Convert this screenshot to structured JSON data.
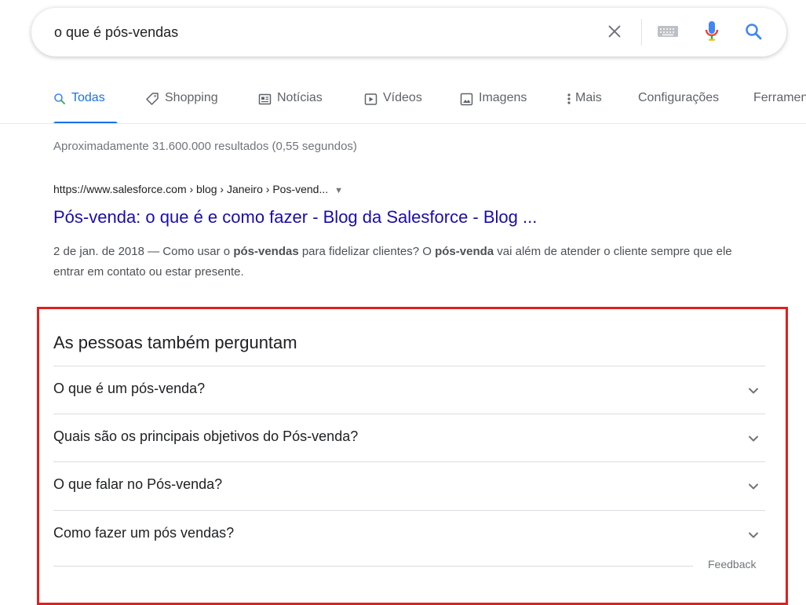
{
  "search": {
    "query": "o que é pós-vendas",
    "clear_icon": "close-icon",
    "keyboard_icon": "keyboard-icon",
    "mic_icon": "microphone-icon",
    "search_icon": "search-icon"
  },
  "tabs": [
    {
      "label": "Todas",
      "icon": "search-icon",
      "active": true
    },
    {
      "label": "Shopping",
      "icon": "tag-icon"
    },
    {
      "label": "Notícias",
      "icon": "newspaper-icon"
    },
    {
      "label": "Vídeos",
      "icon": "play-icon"
    },
    {
      "label": "Imagens",
      "icon": "image-icon"
    },
    {
      "label": "Mais",
      "icon": "more-vert-icon"
    },
    {
      "label": "Configurações"
    },
    {
      "label": "Ferramentas"
    }
  ],
  "results_stats": "Aproximadamente 31.600.000 resultados (0,55 segundos)",
  "result": {
    "url": "https://www.salesforce.com › blog › Janeiro › Pos-vend...",
    "url_caret": "▼",
    "title": "Pós-venda: o que é e como fazer - Blog da Salesforce - Blog ...",
    "snippet_date": "2 de jan. de 2018 — Como usar o ",
    "snippet_b1": "pós-vendas",
    "snippet_t2": " para fidelizar clientes? O ",
    "snippet_b2": "pós-venda",
    "snippet_t3": " vai além de atender o cliente sempre que ele entrar em contato ou estar presente."
  },
  "paa": {
    "heading": "As pessoas também perguntam",
    "questions": [
      "O que é um pós-venda?",
      "Quais são os principais objetivos do Pós-venda?",
      "O que falar no Pós-venda?",
      "Como fazer um pós vendas?"
    ],
    "feedback": "Feedback"
  },
  "colors": {
    "accent": "#1a73e8",
    "link": "#1a0dab",
    "highlight_border": "#e01f1f"
  }
}
